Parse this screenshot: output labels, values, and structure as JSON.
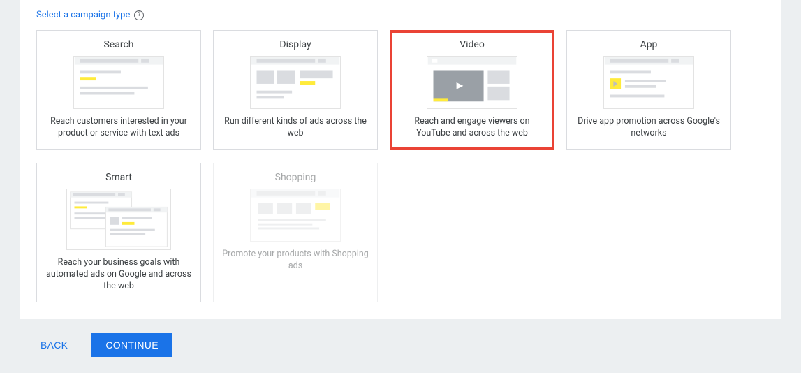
{
  "section": {
    "title": "Select a campaign type"
  },
  "cards": {
    "search": {
      "title": "Search",
      "desc": "Reach customers interested in your product or service with text ads"
    },
    "display": {
      "title": "Display",
      "desc": "Run different kinds of ads across the web"
    },
    "video": {
      "title": "Video",
      "desc": "Reach and engage viewers on YouTube and across the web"
    },
    "app": {
      "title": "App",
      "desc": "Drive app promotion across Google's networks"
    },
    "smart": {
      "title": "Smart",
      "desc": "Reach your business goals with automated ads on Google and across the web"
    },
    "shopping": {
      "title": "Shopping",
      "desc": "Promote your products with Shopping ads"
    }
  },
  "footer": {
    "back": "BACK",
    "continue": "CONTINUE"
  }
}
